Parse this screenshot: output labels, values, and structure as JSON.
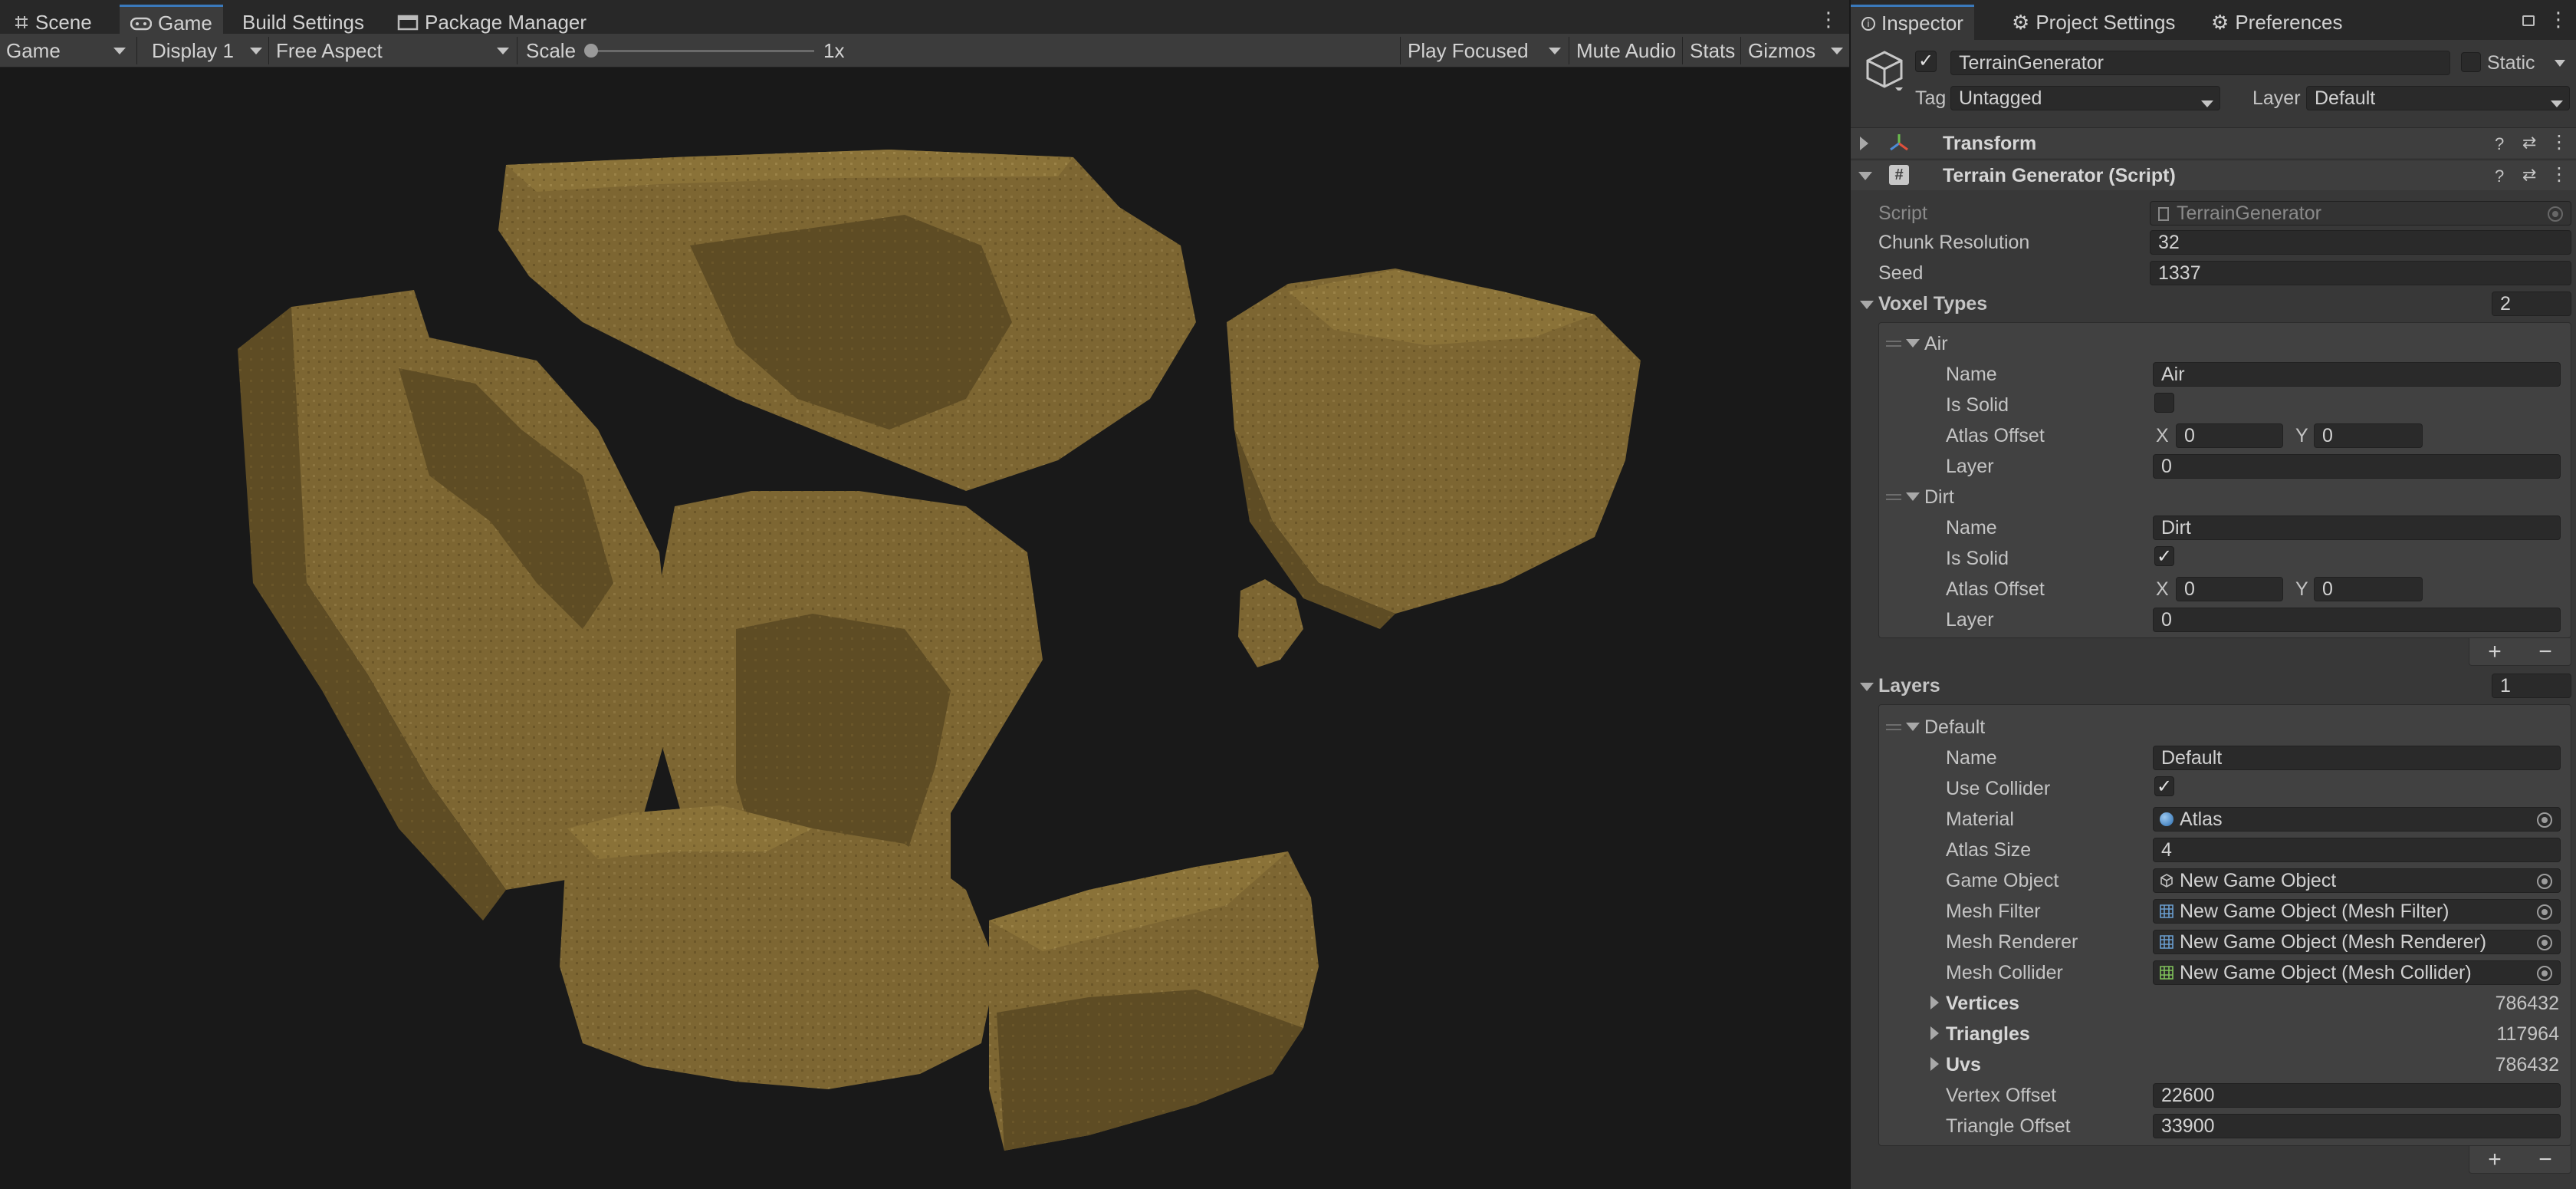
{
  "tabs": {
    "scene": "Scene",
    "game": "Game",
    "build_settings": "Build Settings",
    "package_manager": "Package Manager"
  },
  "toolbar": {
    "view_mode": "Game",
    "display": "Display 1",
    "aspect": "Free Aspect",
    "scale_label": "Scale",
    "scale_value": "1x",
    "play_mode": "Play Focused",
    "mute_audio": "Mute Audio",
    "stats": "Stats",
    "gizmos": "Gizmos"
  },
  "inspector_tabs": {
    "inspector": "Inspector",
    "project_settings": "Project Settings",
    "preferences": "Preferences"
  },
  "object": {
    "name": "TerrainGenerator",
    "static_label": "Static",
    "tag_label": "Tag",
    "tag_value": "Untagged",
    "layer_label": "Layer",
    "layer_value": "Default"
  },
  "components": {
    "transform": "Transform",
    "terrain_generator": "Terrain Generator (Script)"
  },
  "script": {
    "script_label": "Script",
    "script_value": "TerrainGenerator",
    "chunk_resolution_label": "Chunk Resolution",
    "chunk_resolution_value": "32",
    "seed_label": "Seed",
    "seed_value": "1337"
  },
  "voxel_types": {
    "label": "Voxel Types",
    "count": "2",
    "items": [
      {
        "title": "Air",
        "name_label": "Name",
        "name_value": "Air",
        "is_solid_label": "Is Solid",
        "atlas_label": "Atlas Offset",
        "x_label": "X",
        "x_value": "0",
        "y_label": "Y",
        "y_value": "0",
        "layer_label": "Layer",
        "layer_value": "0"
      },
      {
        "title": "Dirt",
        "name_label": "Name",
        "name_value": "Dirt",
        "is_solid_label": "Is Solid",
        "is_solid_check": "✓",
        "atlas_label": "Atlas Offset",
        "x_label": "X",
        "x_value": "0",
        "y_label": "Y",
        "y_value": "0",
        "layer_label": "Layer",
        "layer_value": "0"
      }
    ]
  },
  "layers": {
    "label": "Layers",
    "count": "1",
    "item": {
      "title": "Default",
      "name_label": "Name",
      "name_value": "Default",
      "use_collider_label": "Use Collider",
      "use_collider_check": "✓",
      "material_label": "Material",
      "material_value": "Atlas",
      "atlas_size_label": "Atlas Size",
      "atlas_size_value": "4",
      "game_object_label": "Game Object",
      "game_object_value": "New Game Object",
      "mesh_filter_label": "Mesh Filter",
      "mesh_filter_value": "New Game Object (Mesh Filter)",
      "mesh_renderer_label": "Mesh Renderer",
      "mesh_renderer_value": "New Game Object (Mesh Renderer)",
      "mesh_collider_label": "Mesh Collider",
      "mesh_collider_value": "New Game Object (Mesh Collider)",
      "vertices_label": "Vertices",
      "vertices_value": "786432",
      "triangles_label": "Triangles",
      "triangles_value": "117964",
      "uvs_label": "Uvs",
      "uvs_value": "786432",
      "vertex_offset_label": "Vertex Offset",
      "vertex_offset_value": "22600",
      "triangle_offset_label": "Triangle Offset",
      "triangle_offset_value": "33900"
    }
  },
  "buttons": {
    "plus": "+",
    "minus": "−"
  },
  "colors": {
    "accent": "#3a79bb",
    "terrain": "#7f6834",
    "background": "#191919",
    "panel": "#383838"
  }
}
